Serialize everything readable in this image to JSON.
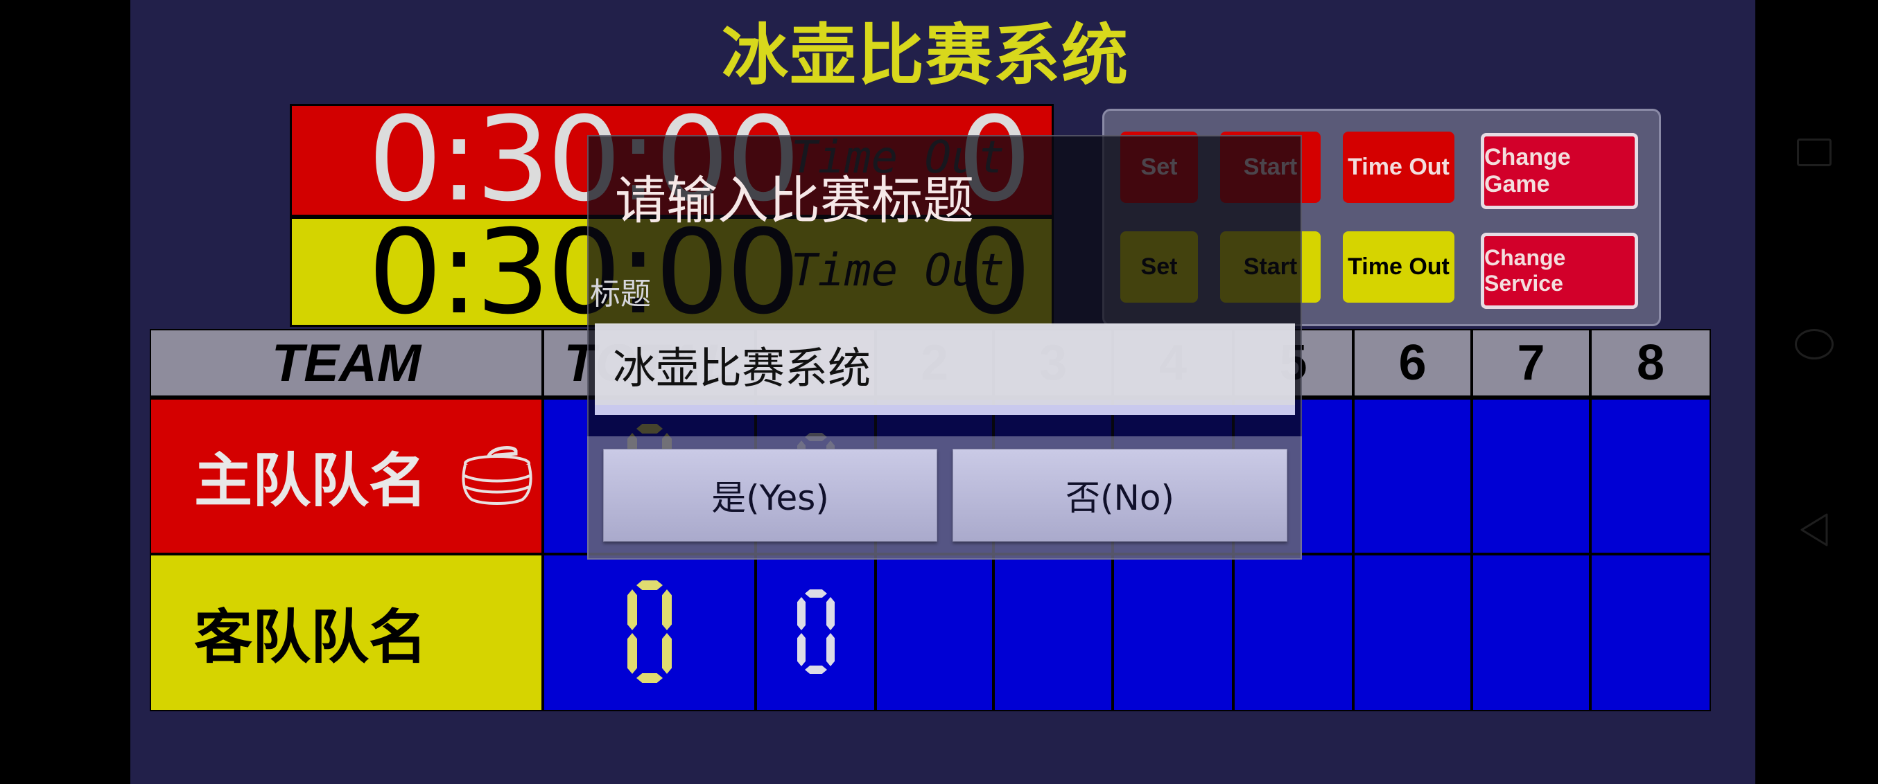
{
  "app": {
    "title": "冰壶比赛系统"
  },
  "timers": {
    "home": {
      "clock": "0:30:00",
      "timeout_label": "Time Out",
      "timeout_count": "0"
    },
    "away": {
      "clock": "0:30:00",
      "timeout_label": "Time Out",
      "timeout_count": "0"
    }
  },
  "controls": {
    "home_row": [
      {
        "label": "Set"
      },
      {
        "label": "Start"
      },
      {
        "label": "Time Out"
      },
      {
        "label": "Change Game"
      }
    ],
    "away_row": [
      {
        "label": "Set"
      },
      {
        "label": "Start"
      },
      {
        "label": "Time Out"
      },
      {
        "label": "Change Service"
      }
    ]
  },
  "scoreboard": {
    "headers": [
      "TEAM",
      "TOTAL",
      "1",
      "2",
      "3",
      "4",
      "5",
      "6",
      "7",
      "8"
    ],
    "highlighted_end": "1",
    "teams": [
      {
        "name": "主队队名",
        "has_hammer": true,
        "icon": "curling-stone-icon",
        "total": "0",
        "ends": [
          "0",
          "",
          "",
          "",
          "",
          "",
          "",
          ""
        ]
      },
      {
        "name": "客队队名",
        "has_hammer": false,
        "total": "0",
        "ends": [
          "0",
          "",
          "",
          "",
          "",
          "",
          "",
          ""
        ]
      }
    ]
  },
  "dialog": {
    "title": "请输入比赛标题",
    "field_label": "标题",
    "input_value": "冰壶比赛系统",
    "yes_label": "是(Yes)",
    "no_label": "否(No)"
  },
  "system_nav": {
    "icons": [
      "recent-apps-icon",
      "home-icon",
      "back-icon"
    ]
  },
  "colors": {
    "background": "#22204a",
    "title": "#d8d81c",
    "home": "#d40000",
    "away": "#d6d400",
    "score_cell": "#0000d4",
    "header_cell": "#8e8c9c",
    "total_digit": "#e0dc70",
    "end_digit": "#dcdce6"
  }
}
